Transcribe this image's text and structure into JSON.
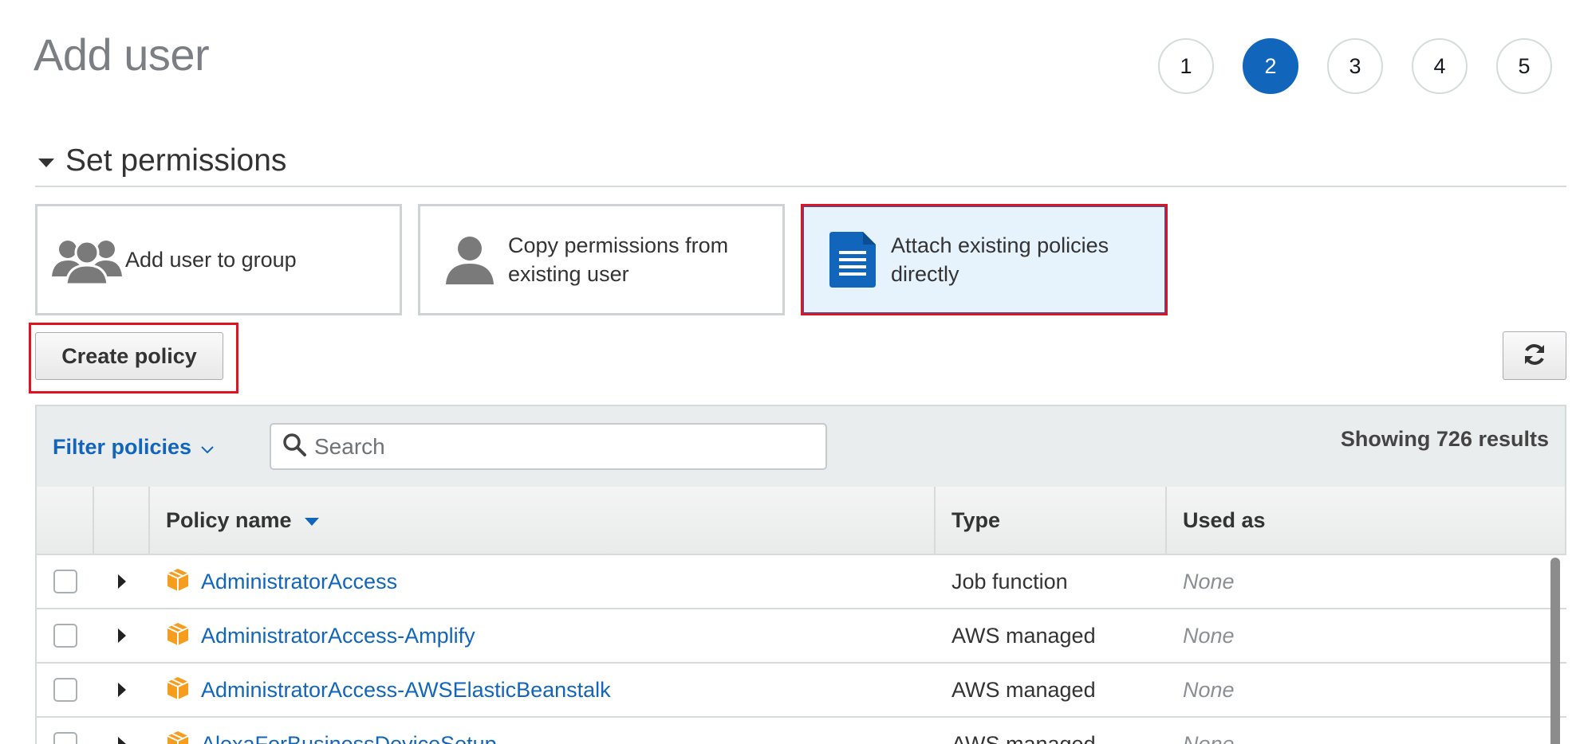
{
  "page": {
    "title": "Add user"
  },
  "steps": [
    "1",
    "2",
    "3",
    "4",
    "5"
  ],
  "active_step": "2",
  "section": {
    "title": "Set permissions"
  },
  "options": [
    {
      "label": "Add user to group",
      "icon": "group-icon",
      "selected": false
    },
    {
      "label": "Copy permissions from existing user",
      "icon": "user-icon",
      "selected": false
    },
    {
      "label": "Attach existing policies directly",
      "icon": "document-icon",
      "selected": true
    }
  ],
  "toolbar": {
    "create_policy_label": "Create policy",
    "refresh_icon": "refresh-icon"
  },
  "filter": {
    "label": "Filter policies",
    "search_placeholder": "Search",
    "results_text": "Showing 726 results"
  },
  "table": {
    "columns": {
      "name": "Policy name",
      "type": "Type",
      "used_as": "Used as"
    },
    "rows": [
      {
        "name": "AdministratorAccess",
        "type": "Job function",
        "used_as": "None"
      },
      {
        "name": "AdministratorAccess-Amplify",
        "type": "AWS managed",
        "used_as": "None"
      },
      {
        "name": "AdministratorAccess-AWSElasticBeanstalk",
        "type": "AWS managed",
        "used_as": "None"
      },
      {
        "name": "AlexaForBusinessDeviceSetup",
        "type": "AWS managed",
        "used_as": "None"
      }
    ]
  },
  "colors": {
    "accent": "#1166bb",
    "highlight": "#e0141e",
    "policy_icon": "#f59d1f"
  }
}
